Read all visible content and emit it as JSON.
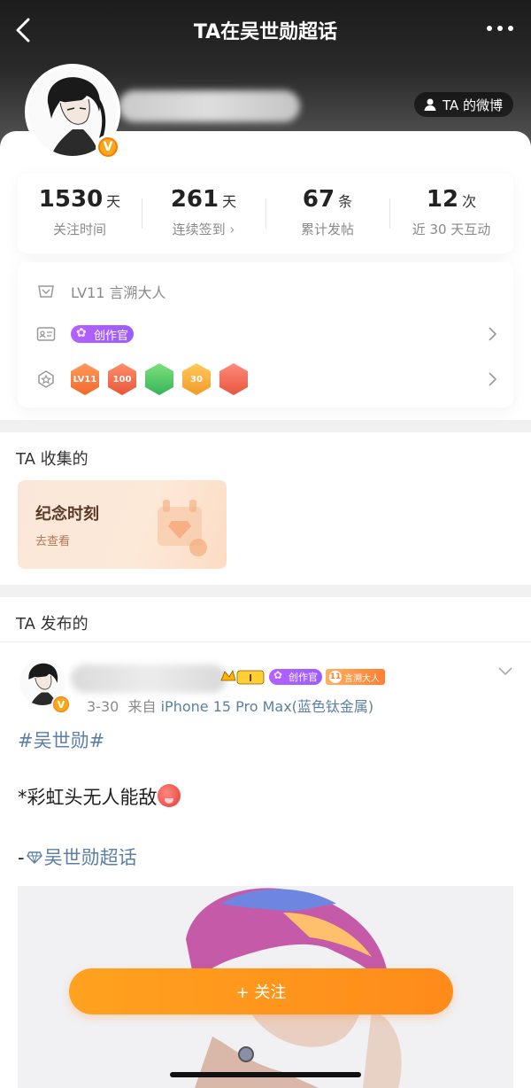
{
  "header": {
    "title": "TA在吴世勋超话",
    "weibo_link": "TA 的微博"
  },
  "stats": [
    {
      "num": "1530",
      "unit": "天",
      "label": "关注时间"
    },
    {
      "num": "261",
      "unit": "天",
      "label": "连续签到",
      "chevron": "›"
    },
    {
      "num": "67",
      "unit": "条",
      "label": "累计发帖"
    },
    {
      "num": "12",
      "unit": "次",
      "label": "近 30 天互动"
    }
  ],
  "info": {
    "level_text": "LV11 言溯大人",
    "creator_badge": "创作官",
    "medals": [
      "LV11",
      "100",
      "",
      "30",
      ""
    ]
  },
  "collected": {
    "title": "TA 收集的",
    "card_title": "纪念时刻",
    "card_sub": "去查看"
  },
  "posts": {
    "title": "TA 发布的",
    "post": {
      "badge_level": "I",
      "badge_creator": "创作官",
      "badge_title_num": "11",
      "badge_title": "言溯大人",
      "date": "3-30",
      "from": "来自",
      "device": "iPhone 15 Pro Max(蓝色钛金属)",
      "topic": "#吴世勋#",
      "text": "*彩虹头无人能敌",
      "dash": "-",
      "super_link": "吴世勋超话"
    }
  },
  "follow_button": "+ 关注",
  "colors": {
    "accent_orange": "#ff8b1a",
    "link_blue": "#5b7fa6",
    "creator_purple": "#a05cff"
  }
}
